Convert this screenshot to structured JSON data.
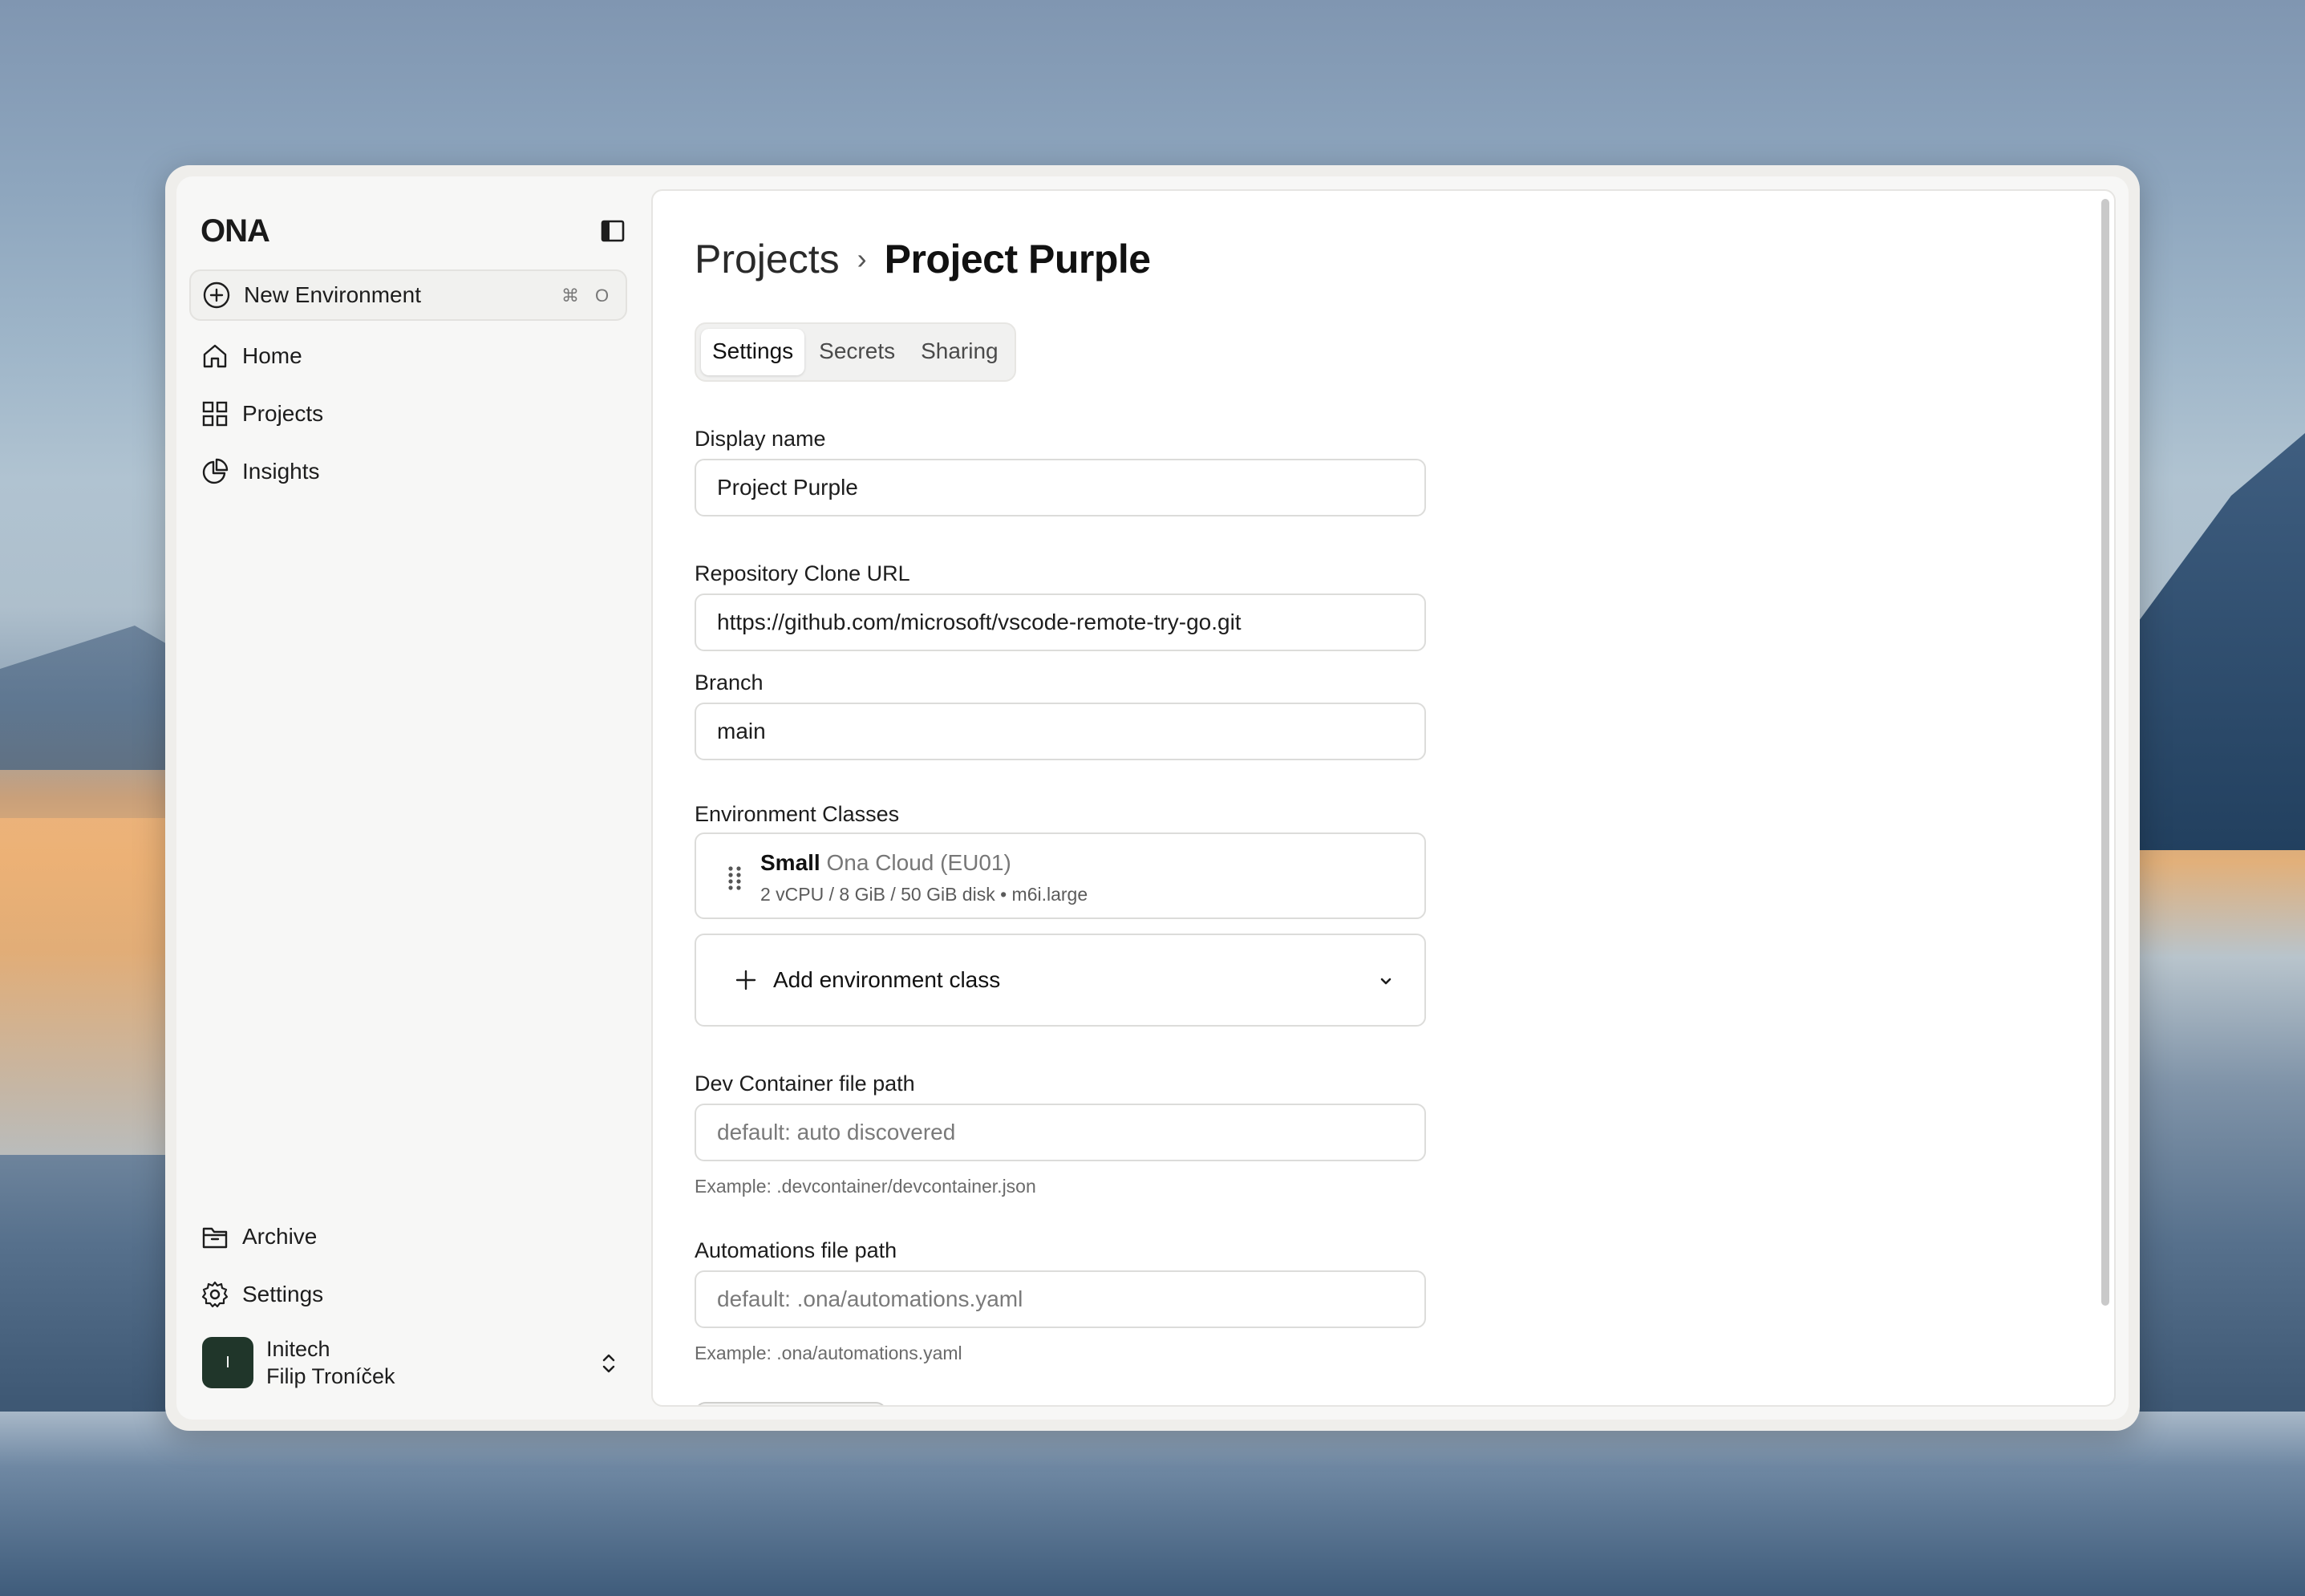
{
  "sidebar": {
    "logo": "ONA",
    "new_env": {
      "label": "New Environment",
      "shortcut_key1": "⌘",
      "shortcut_key2": "O"
    },
    "nav": [
      {
        "label": "Home",
        "icon": "home-icon"
      },
      {
        "label": "Projects",
        "icon": "grid-icon"
      },
      {
        "label": "Insights",
        "icon": "pie-chart-icon"
      }
    ],
    "bottom_nav": [
      {
        "label": "Archive",
        "icon": "archive-icon"
      },
      {
        "label": "Settings",
        "icon": "gear-icon"
      }
    ],
    "user": {
      "avatar_letter": "I",
      "org": "Initech",
      "name": "Filip Troníček"
    }
  },
  "main": {
    "breadcrumb": {
      "parent": "Projects",
      "separator": "›",
      "current": "Project Purple"
    },
    "tabs": [
      {
        "label": "Settings",
        "active": true
      },
      {
        "label": "Secrets",
        "active": false
      },
      {
        "label": "Sharing",
        "active": false
      }
    ],
    "display_name": {
      "label": "Display name",
      "value": "Project Purple"
    },
    "repo_url": {
      "label": "Repository Clone URL",
      "value": "https://github.com/microsoft/vscode-remote-try-go.git"
    },
    "branch": {
      "label": "Branch",
      "value": "main"
    },
    "env_classes": {
      "label": "Environment Classes",
      "items": [
        {
          "name": "Small",
          "provider": "Ona Cloud (EU01)",
          "spec": "2 vCPU / 8 GiB / 50 GiB disk • m6i.large"
        }
      ],
      "add_label": "Add environment class"
    },
    "devcontainer": {
      "label": "Dev Container file path",
      "placeholder": "default: auto discovered",
      "hint": "Example: .devcontainer/devcontainer.json"
    },
    "automations": {
      "label": "Automations file path",
      "placeholder": "default: .ona/automations.yaml",
      "hint": "Example: .ona/automations.yaml"
    }
  }
}
